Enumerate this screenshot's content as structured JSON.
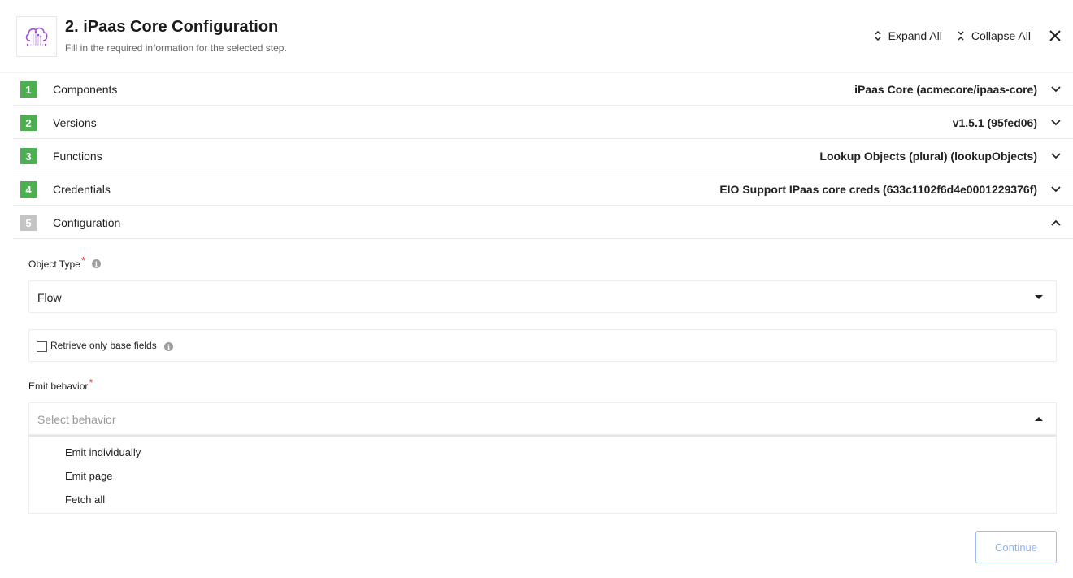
{
  "header": {
    "logo_icon": "cloud-network-icon",
    "title": "2. iPaas Core Configuration",
    "subtitle": "Fill in the required information for the selected step.",
    "expand_all_label": "Expand All",
    "collapse_all_label": "Collapse All",
    "expand_icon": "chevron-expand-icon",
    "collapse_icon": "chevron-collapse-icon",
    "close_icon": "close-icon"
  },
  "steps": [
    {
      "number": "1",
      "label": "Components",
      "value": "iPaas Core (acmecore/ipaas-core)",
      "status": "complete",
      "expanded": false
    },
    {
      "number": "2",
      "label": "Versions",
      "value": "v1.5.1 (95fed06)",
      "status": "complete",
      "expanded": false
    },
    {
      "number": "3",
      "label": "Functions",
      "value": "Lookup Objects (plural) (lookupObjects)",
      "status": "complete",
      "expanded": false
    },
    {
      "number": "4",
      "label": "Credentials",
      "value": "EIO Support IPaas core creds (633c1102f6d4e0001229376f)",
      "status": "complete",
      "expanded": false
    },
    {
      "number": "5",
      "label": "Configuration",
      "value": "",
      "status": "active",
      "expanded": true
    }
  ],
  "colors": {
    "step_complete": "#4caf50",
    "step_inactive": "#c4c4c4",
    "required_star": "#e53935",
    "continue_border": "#9dbdf2",
    "continue_text": "#8fb3ee"
  },
  "configuration": {
    "object_type": {
      "label": "Object Type",
      "required_mark": "*",
      "info_glyph": "i",
      "value": "Flow"
    },
    "retrieve_base_fields": {
      "label": "Retrieve only base fields",
      "checked": false,
      "info_glyph": "i"
    },
    "emit_behavior": {
      "label": "Emit behavior",
      "required_mark": "*",
      "placeholder": "Select behavior",
      "open": true,
      "options": [
        "Emit individually",
        "Emit page",
        "Fetch all"
      ]
    }
  },
  "footer": {
    "continue_label": "Continue",
    "continue_disabled": true
  }
}
